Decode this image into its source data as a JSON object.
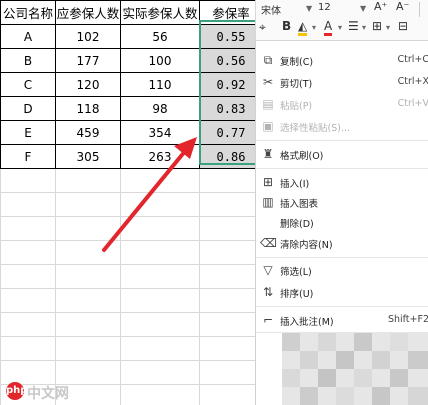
{
  "table": {
    "headers": [
      "公司名称",
      "应参保人数",
      "实际参保人数",
      "参保率"
    ],
    "rows": [
      [
        "A",
        "102",
        "56",
        "0.55"
      ],
      [
        "B",
        "177",
        "100",
        "0.56"
      ],
      [
        "C",
        "120",
        "110",
        "0.92"
      ],
      [
        "D",
        "118",
        "98",
        "0.83"
      ],
      [
        "E",
        "459",
        "354",
        "0.77"
      ],
      [
        "F",
        "305",
        "263",
        "0.86"
      ]
    ]
  },
  "colors": {
    "selection": "#3aa17e",
    "selected_fill": "#d9d9d9",
    "arrow": "#e2262b",
    "font_color_underline": "#e2262b",
    "fill_color_underline": "#f5c400"
  },
  "toolbar": {
    "font_name": "宋体",
    "font_size": "12",
    "grow_font": "A⁺",
    "shrink_font": "A⁻",
    "bold": "B",
    "fill_color": "◭",
    "font_color": "A",
    "align": "☰",
    "borders": "⊞",
    "merge": "⊟",
    "icons": [
      "brush-icon",
      "bold-icon",
      "fill-color-icon",
      "font-color-icon",
      "align-icon",
      "border-icon",
      "merge-icon"
    ]
  },
  "menu": {
    "items": [
      {
        "label": "复制(C)",
        "shortcut": "Ctrl+C",
        "icon": "copy-icon",
        "glyph": "⧉",
        "disabled": false
      },
      {
        "label": "剪切(T)",
        "shortcut": "Ctrl+X",
        "icon": "scissors-icon",
        "glyph": "✂",
        "disabled": false
      },
      {
        "label": "粘贴(P)",
        "shortcut": "Ctrl+V",
        "icon": "paste-icon",
        "glyph": "▤",
        "disabled": true
      },
      {
        "label": "选择性粘贴(S)...",
        "shortcut": "",
        "icon": "paste-special-icon",
        "glyph": "▣",
        "disabled": true
      },
      {
        "label": "格式刷(O)",
        "shortcut": "",
        "icon": "format-painter-icon",
        "glyph": "♜",
        "disabled": false
      },
      {
        "label": "插入(I)",
        "shortcut": "",
        "icon": "insert-icon",
        "glyph": "⊞",
        "disabled": false
      },
      {
        "label": "插入图表",
        "shortcut": "",
        "icon": "chart-icon",
        "glyph": "▥",
        "disabled": false
      },
      {
        "label": "删除(D)",
        "shortcut": "",
        "icon": "",
        "glyph": "",
        "disabled": false
      },
      {
        "label": "清除内容(N)",
        "shortcut": "",
        "icon": "eraser-icon",
        "glyph": "⌫",
        "disabled": false
      },
      {
        "label": "筛选(L)",
        "shortcut": "",
        "icon": "filter-icon",
        "glyph": "▽",
        "disabled": false
      },
      {
        "label": "排序(U)",
        "shortcut": "",
        "icon": "sort-icon",
        "glyph": "⇅",
        "disabled": false
      },
      {
        "label": "插入批注(M)",
        "shortcut": "Shift+F2",
        "icon": "comment-icon",
        "glyph": "⌐",
        "disabled": false
      }
    ]
  },
  "watermark": {
    "logo": "php",
    "text": "中文网"
  }
}
